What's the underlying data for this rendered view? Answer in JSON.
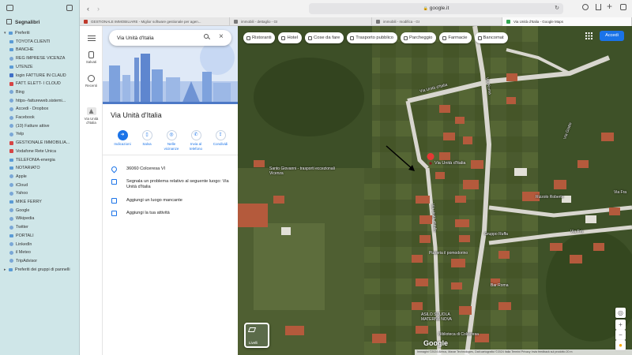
{
  "browser": {
    "address": "google.it",
    "tabs": [
      {
        "label": "GESTIONALE IMMOBILIARE - Miglior software gestionale per agen...",
        "color": "#c0392b",
        "width": 190
      },
      {
        "label": "immobili - dettaglio - GI",
        "color": "#7a7a7a",
        "width": 180
      },
      {
        "label": "immobili - modifica - GI",
        "color": "#7a7a7a",
        "width": 165
      },
      {
        "label": "Via Unità d'Italia - Google Maps",
        "color": "#34a853",
        "width": 164
      }
    ]
  },
  "sidebar": {
    "title": "Segnalibri",
    "items": [
      {
        "label": "Preferiti",
        "icon": "chevron-down-icon",
        "indent": 0,
        "kind": "chevron"
      },
      {
        "label": "TOYOTA CLIENTI",
        "icon": "folder-icon",
        "indent": 1,
        "kind": "folder"
      },
      {
        "label": "BANCHE",
        "icon": "folder-icon",
        "indent": 1,
        "kind": "folder"
      },
      {
        "label": "REG IMPRESE  VICENZA",
        "icon": "bookmark-icon",
        "indent": 1,
        "kind": "bm"
      },
      {
        "label": "UTENZE",
        "icon": "folder-icon",
        "indent": 1,
        "kind": "folder"
      },
      {
        "label": "login FATTURE IN CLAUD",
        "icon": "bookmark-icon",
        "indent": 1,
        "kind": "blue"
      },
      {
        "label": "FATT. ELETT- I CLOUD",
        "icon": "bookmark-icon",
        "indent": 1,
        "kind": "red"
      },
      {
        "label": "Bing",
        "icon": "bookmark-icon",
        "indent": 1,
        "kind": "bm"
      },
      {
        "label": "https--fattureweb.sistemi...",
        "icon": "bookmark-icon",
        "indent": 1,
        "kind": "bm"
      },
      {
        "label": "Accedi - Dropbox",
        "icon": "bookmark-icon",
        "indent": 1,
        "kind": "bm"
      },
      {
        "label": "Facebook",
        "icon": "bookmark-icon",
        "indent": 1,
        "kind": "bm"
      },
      {
        "label": "(10) Fatture attive",
        "icon": "bookmark-icon",
        "indent": 1,
        "kind": "bm"
      },
      {
        "label": "Yelp",
        "icon": "bookmark-icon",
        "indent": 1,
        "kind": "bm"
      },
      {
        "label": "GESTIONALE IMMOBILIA...",
        "icon": "bookmark-icon",
        "indent": 1,
        "kind": "red"
      },
      {
        "label": "Vodafone Rete Unica",
        "icon": "bookmark-icon",
        "indent": 1,
        "kind": "red"
      },
      {
        "label": "TELEFONIA-energia",
        "icon": "folder-icon",
        "indent": 1,
        "kind": "folder"
      },
      {
        "label": "NOTARIATO",
        "icon": "folder-icon",
        "indent": 1,
        "kind": "folder"
      },
      {
        "label": "Apple",
        "icon": "bookmark-icon",
        "indent": 1,
        "kind": "bm"
      },
      {
        "label": "iCloud",
        "icon": "bookmark-icon",
        "indent": 1,
        "kind": "bm"
      },
      {
        "label": "Yahoo",
        "icon": "bookmark-icon",
        "indent": 1,
        "kind": "bm"
      },
      {
        "label": "MIKE FERRY",
        "icon": "folder-icon",
        "indent": 1,
        "kind": "folder"
      },
      {
        "label": "Google",
        "icon": "bookmark-icon",
        "indent": 1,
        "kind": "bm"
      },
      {
        "label": "Wikipedia",
        "icon": "bookmark-icon",
        "indent": 1,
        "kind": "bm"
      },
      {
        "label": "Twitter",
        "icon": "bookmark-icon",
        "indent": 1,
        "kind": "bm"
      },
      {
        "label": "PORTALI",
        "icon": "folder-icon",
        "indent": 1,
        "kind": "folder"
      },
      {
        "label": "LinkedIn",
        "icon": "bookmark-icon",
        "indent": 1,
        "kind": "bm"
      },
      {
        "label": "il Meteo",
        "icon": "bookmark-icon",
        "indent": 1,
        "kind": "bm"
      },
      {
        "label": "TripAdvisor",
        "icon": "bookmark-icon",
        "indent": 1,
        "kind": "bm"
      },
      {
        "label": "Preferiti dei gruppi di pannelli",
        "icon": "chevron-right-icon",
        "indent": 0,
        "kind": "chevron"
      }
    ]
  },
  "rail": {
    "saved": "Salvati",
    "recent": "Recenti",
    "place": "Via Unità d'Italia"
  },
  "panel": {
    "search_value": "Via Unità d'Italia",
    "place_title": "Via Unità d'Italia",
    "actions": [
      {
        "label": "Indicazioni",
        "icon": "directions-icon"
      },
      {
        "label": "Salva",
        "icon": "bookmark-icon"
      },
      {
        "label": "Nelle vicinanze",
        "icon": "nearby-icon"
      },
      {
        "label": "Invia al telefono",
        "icon": "phone-icon"
      },
      {
        "label": "Condividi",
        "icon": "share-icon"
      }
    ],
    "info": [
      {
        "text": "36060 Colceresa VI",
        "icon": "location-pin-icon"
      },
      {
        "text": "Segnala un problema relativo al seguente luogo: Via Unità d'Italia",
        "icon": "edit-icon"
      },
      {
        "text": "Aggiungi un luogo mancante",
        "icon": "add-place-icon"
      },
      {
        "text": "Aggiungi la tua attività",
        "icon": "add-business-icon"
      }
    ]
  },
  "map": {
    "chips": [
      {
        "label": "Ristoranti",
        "icon": "restaurant-icon"
      },
      {
        "label": "Hotel",
        "icon": "hotel-icon"
      },
      {
        "label": "Cose da fare",
        "icon": "camera-icon"
      },
      {
        "label": "Trasporto pubblico",
        "icon": "transit-icon"
      },
      {
        "label": "Parcheggio",
        "icon": "parking-icon"
      },
      {
        "label": "Farmacie",
        "icon": "pharmacy-icon"
      },
      {
        "label": "Bancomat",
        "icon": "more-icon"
      }
    ],
    "signin": "Accedi",
    "labels": {
      "road_roma": "Via Roma",
      "road_unita_top": "Via Unità d'Italia",
      "road_unita_mid": "Via Unità d'Italia",
      "road_giotto": "Via Giotto",
      "road_f1": "Via Frà",
      "road_f2": "Via Fra",
      "pin": "Via Unità d'Italia",
      "church": "Santo Giovanni - trasporti eccezionali Vicenza",
      "rizzolo": "Rizzolo Roberto",
      "gruppo": "Gruppo Ruffa",
      "pizzeria": "Pizzeria il pomodorino",
      "bar": "Bar Roma",
      "asilo": "ASILO SCUOLA MATERNA NOVA",
      "biblioteca": "Biblioteca di Colceresa",
      "via_unita_v": "Via Unità d'Italia"
    },
    "layers_label": "Livelli",
    "google_logo": "Google",
    "footer": "Immagini ©2024 Airbus, Maxar Technologies, Dati cartografici ©2024  Italia  Termini  Privacy  Invia feedback sul prodotto  20 m"
  }
}
